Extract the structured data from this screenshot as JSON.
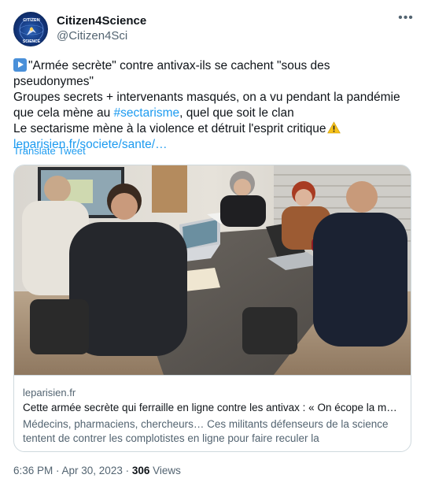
{
  "author": {
    "name": "Citizen4Science",
    "handle": "@Citizen4Sci",
    "avatar_text_top": "CITIZEN",
    "avatar_text_bottom": "SCIENCE"
  },
  "tweet": {
    "line1": "\"Armée secrète\" contre antivax-ils se cachent \"sous des",
    "line2": "pseudonymes\"",
    "line3": "Groupes secrets + intervenants  masqués, on a vu pendant la pandémie",
    "line4_prefix": "que cela mène au ",
    "hashtag": "#sectarisme",
    "line4_suffix": ", quel que soit le clan",
    "line5": "Le sectarisme mène à la violence et détruit l'esprit critique",
    "link": "leparisien.fr/societe/sante/…",
    "play_icon": "play-button-icon",
    "warning_icon": "warning-icon"
  },
  "translate_label": "Translate Tweet",
  "card": {
    "domain": "leparisien.fr",
    "title": "Cette armée secrète qui ferraille en ligne contre les antivax : « On écope la m…",
    "description_line1": "Médecins, pharmaciens, chercheurs… Ces militants défenseurs de la science",
    "description_line2": "tentent de contrer les complotistes en ligne pour faire reculer la"
  },
  "footer": {
    "timestamp": "6:36 PM · Apr 30, 2023 · ",
    "views_count": "306",
    "views_label": " Views"
  },
  "colors": {
    "link": "#1d9bf0",
    "secondary_text": "#536471",
    "border": "#cfd9de"
  }
}
